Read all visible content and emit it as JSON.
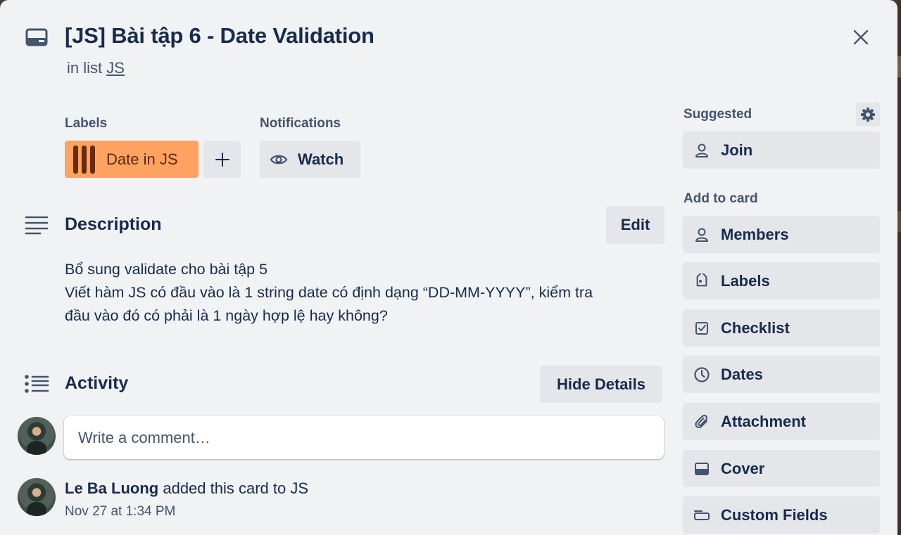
{
  "card": {
    "title": "[JS] Bài tập 6 - Date Validation",
    "in_list_prefix": "in list",
    "list_name": "JS"
  },
  "labels": {
    "heading": "Labels",
    "items": [
      {
        "text": "Date in JS",
        "color": "#fea362"
      }
    ],
    "add_symbol": "+"
  },
  "notifications": {
    "heading": "Notifications",
    "watch_label": "Watch"
  },
  "description": {
    "heading": "Description",
    "edit_label": "Edit",
    "lines": [
      "Bổ sung validate cho bài tập 5",
      "Viết hàm JS có đầu vào là 1 string date có định dạng “DD-MM-YYYY”, kiểm tra",
      "đầu vào đó có phải là 1 ngày hợp lệ hay không?"
    ]
  },
  "activity": {
    "heading": "Activity",
    "hide_details_label": "Hide Details",
    "comment_placeholder": "Write a comment…",
    "entries": [
      {
        "user": "Le Ba Luong",
        "action": "added this card to JS",
        "time": "Nov 27 at 1:34 PM"
      }
    ]
  },
  "sidebar": {
    "suggested_heading": "Suggested",
    "suggested": [
      {
        "label": "Join",
        "icon": "person-icon"
      }
    ],
    "add_to_card_heading": "Add to card",
    "add_to_card": [
      {
        "label": "Members",
        "icon": "person-icon"
      },
      {
        "label": "Labels",
        "icon": "tag-icon"
      },
      {
        "label": "Checklist",
        "icon": "checkbox-icon"
      },
      {
        "label": "Dates",
        "icon": "clock-icon"
      },
      {
        "label": "Attachment",
        "icon": "paperclip-icon"
      },
      {
        "label": "Cover",
        "icon": "cover-icon"
      },
      {
        "label": "Custom Fields",
        "icon": "custom-fields-icon"
      }
    ]
  },
  "colors": {
    "modal_bg": "#f1f2f4",
    "button_bg": "#e4e6ea",
    "label_orange": "#fea362",
    "text_primary": "#172b4d",
    "text_subtle": "#44546f"
  }
}
